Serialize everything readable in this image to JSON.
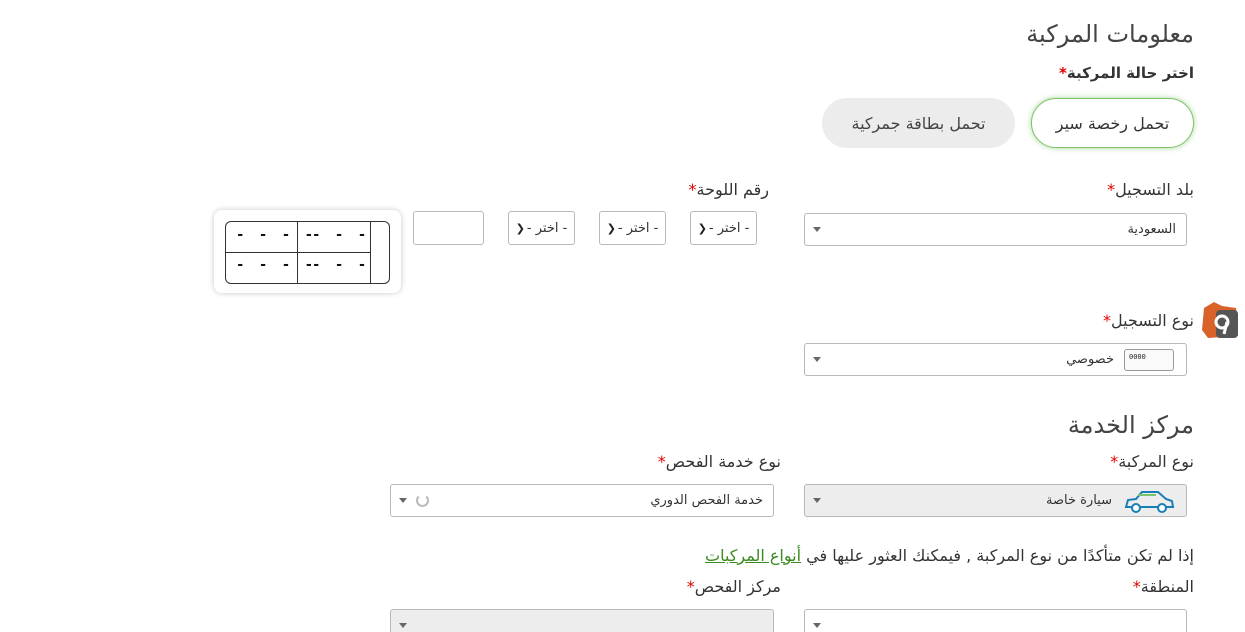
{
  "vehicle_info": {
    "title": "معلومات المركبة",
    "status_label": "اختر حالة المركبة",
    "required_mark": "*",
    "options": [
      {
        "label": "تحمل رخصة سير",
        "selected": true
      },
      {
        "label": "تحمل بطاقة جمركية",
        "selected": false
      }
    ]
  },
  "registration_country": {
    "label": "بلد التسجيل",
    "required_mark": "*",
    "value": "السعودية"
  },
  "plate_number": {
    "label": "رقم اللوحة",
    "required_mark": "*",
    "selects": [
      {
        "value": "- اختر -"
      },
      {
        "value": "- اختر -"
      },
      {
        "value": "- اختر -"
      }
    ],
    "number_input": "",
    "preview": {
      "top_letters": "- - -",
      "top_numbers": "- - - -",
      "bottom_letters": "- - -",
      "bottom_numbers": "- - - -"
    }
  },
  "registration_type": {
    "label": "نوع التسجيل",
    "required_mark": "*",
    "value": "خصوصي",
    "icon_number": "0000"
  },
  "service_center": {
    "title": "مركز الخدمة",
    "vehicle_type": {
      "label": "نوع المركبة",
      "required_mark": "*",
      "value": "سيارة خاصة"
    },
    "inspection_service_type": {
      "label": "نوع خدمة الفحص",
      "required_mark": "*",
      "value": "خدمة الفحص الدوري"
    },
    "hint_text": "إذا لم تكن متأكدًا من نوع المركبة , فيمكنك العثور عليها في",
    "hint_link": "أنواع المركبات",
    "region": {
      "label": "المنطقة",
      "required_mark": "*"
    },
    "inspection_center": {
      "label": "مركز الفحص",
      "required_mark": "*"
    }
  },
  "colors": {
    "accent_green": "#7bc36a",
    "link_green": "#3a8a1e",
    "required_red": "#e00000",
    "badge_orange": "#d9622b"
  }
}
